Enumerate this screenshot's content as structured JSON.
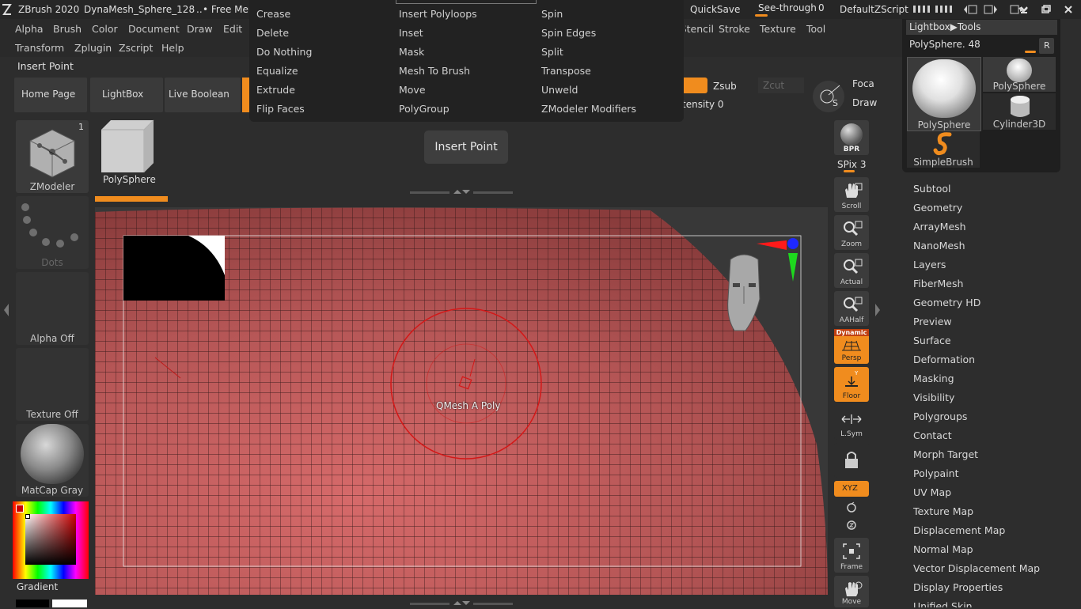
{
  "title": {
    "app": "ZBrush 2020",
    "document": "DynaMesh_Sphere_128",
    "extra": "..",
    "free_mem": "• Free Mem"
  },
  "topright": {
    "quicksave": "QuickSave",
    "seethrough_label": "See-through",
    "seethrough_value": "0",
    "zscript": "DefaultZScript"
  },
  "menu1": [
    "Alpha",
    "Brush",
    "Color",
    "Document",
    "Draw",
    "Edit"
  ],
  "menu1_right": [
    "Stencil",
    "Stroke",
    "Texture",
    "Tool"
  ],
  "menu2": [
    "Transform",
    "Zplugin",
    "Zscript",
    "Help"
  ],
  "status": "Insert Point",
  "nav": {
    "home": "Home Page",
    "lightbox": "LightBox",
    "live_boolean": "Live Boolean"
  },
  "dropdown": {
    "col1": [
      "Crease",
      "Delete",
      "Do Nothing",
      "Equalize",
      "Extrude",
      "Flip Faces"
    ],
    "col2": [
      "Insert Polyloops",
      "Inset",
      "Mask",
      "Mesh To Brush",
      "Move",
      "PolyGroup"
    ],
    "col3": [
      "Spin",
      "Spin Edges",
      "Split",
      "Transpose",
      "Unweld",
      "ZModeler Modifiers"
    ]
  },
  "zbar": {
    "zsub": "Zsub",
    "zcut": "Zcut",
    "intensity": "tensity 0",
    "focal": "Foca",
    "draw": "Draw"
  },
  "tooltip": "Insert Point",
  "left": {
    "brush_label": "ZModeler",
    "brush_count": "1",
    "mesh_label": "PolySphere",
    "stroke_label": "Dots",
    "alpha_label": "Alpha Off",
    "texture_label": "Texture Off",
    "material_label": "MatCap Gray",
    "gradient_label": "Gradient"
  },
  "canvas": {
    "cursor_text": "QMesh A Poly"
  },
  "right_shelf": {
    "bpr": "BPR",
    "spix": "SPix 3",
    "scroll": "Scroll",
    "zoom": "Zoom",
    "actual": "Actual",
    "aahalf": "AAHalf",
    "dynamic": "Dynamic",
    "persp": "Persp",
    "floor": "Floor",
    "lsym": "L.Sym",
    "xyz": "XYZ",
    "frame": "Frame",
    "move": "Move"
  },
  "tool_panel": {
    "header": "Lightbox▶Tools",
    "current": "PolySphere. 48",
    "r": "R",
    "thumbs": [
      "PolySphere",
      "PolySphere",
      "Cylinder3D",
      "SimpleBrush"
    ],
    "items": [
      "Subtool",
      "Geometry",
      "ArrayMesh",
      "NanoMesh",
      "Layers",
      "FiberMesh",
      "Geometry HD",
      "Preview",
      "Surface",
      "Deformation",
      "Masking",
      "Visibility",
      "Polygroups",
      "Contact",
      "Morph Target",
      "Polypaint",
      "UV Map",
      "Texture Map",
      "Displacement Map",
      "Normal Map",
      "Vector Displacement Map",
      "Display Properties",
      "Unified Skin"
    ]
  }
}
